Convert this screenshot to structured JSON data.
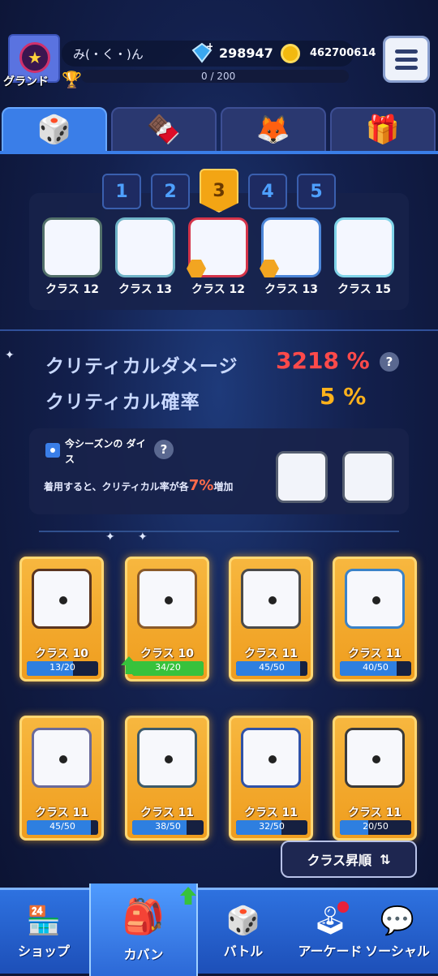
{
  "header": {
    "rank": "グランド",
    "username": "み(・く・)ん",
    "gems": "298947",
    "coins": "462700614",
    "xp": "0 / 200"
  },
  "tabs": [
    {
      "icon": "dice-icon"
    },
    {
      "icon": "chocolate-icon"
    },
    {
      "icon": "character-icon"
    },
    {
      "icon": "item-icon"
    }
  ],
  "deck": {
    "presets": [
      "1",
      "2",
      "3",
      "4",
      "5"
    ],
    "active_preset": "3",
    "dice": [
      {
        "label": "クラス 12",
        "border": "#52706a"
      },
      {
        "label": "クラス 13",
        "border": "#6fb3c6"
      },
      {
        "label": "クラス 12",
        "border": "#d4344a"
      },
      {
        "label": "クラス 13",
        "border": "#4c86d8"
      },
      {
        "label": "クラス 15",
        "border": "#7fd3e8"
      }
    ]
  },
  "stats": {
    "crit_damage_label": "クリティカルダメージ",
    "crit_damage_value": "3218 %",
    "crit_rate_label": "クリティカル確率",
    "crit_rate_value": "5 %",
    "help": "?"
  },
  "season": {
    "title": "今シーズンの ダイス",
    "desc_before": "着用すると、クリティカル率が各",
    "desc_pct": "7%",
    "desc_after": "増加",
    "help": "?"
  },
  "cards": [
    {
      "label": "クラス 10",
      "progress": "13/20",
      "fill": 0.65,
      "border": "#5a3520"
    },
    {
      "label": "クラス 10",
      "progress": "34/20",
      "fill": 1.0,
      "upgradable": true,
      "border": "#8a5a2a"
    },
    {
      "label": "クラス 11",
      "progress": "45/50",
      "fill": 0.9,
      "border": "#4a4a4a"
    },
    {
      "label": "クラス 11",
      "progress": "40/50",
      "fill": 0.8,
      "border": "#3a82c8"
    },
    {
      "label": "クラス 11",
      "progress": "45/50",
      "fill": 0.9,
      "border": "#6a6a9a"
    },
    {
      "label": "クラス 11",
      "progress": "38/50",
      "fill": 0.76,
      "border": "#3d5a6a"
    },
    {
      "label": "クラス 11",
      "progress": "32/50",
      "fill": 0.64,
      "border": "#3052a8"
    },
    {
      "label": "クラス 11",
      "progress": "20/50",
      "fill": 0.4,
      "border": "#3a3a3a"
    }
  ],
  "sort_button": "クラス昇順",
  "nav": [
    {
      "label": "ショップ",
      "icon": "shop-icon"
    },
    {
      "label": "カバン",
      "icon": "bag-icon"
    },
    {
      "label": "バトル",
      "icon": "dice-icon"
    },
    {
      "label": "アーケード",
      "icon": "arcade-icon"
    },
    {
      "label": "ソーシャル",
      "icon": "social-icon"
    }
  ]
}
